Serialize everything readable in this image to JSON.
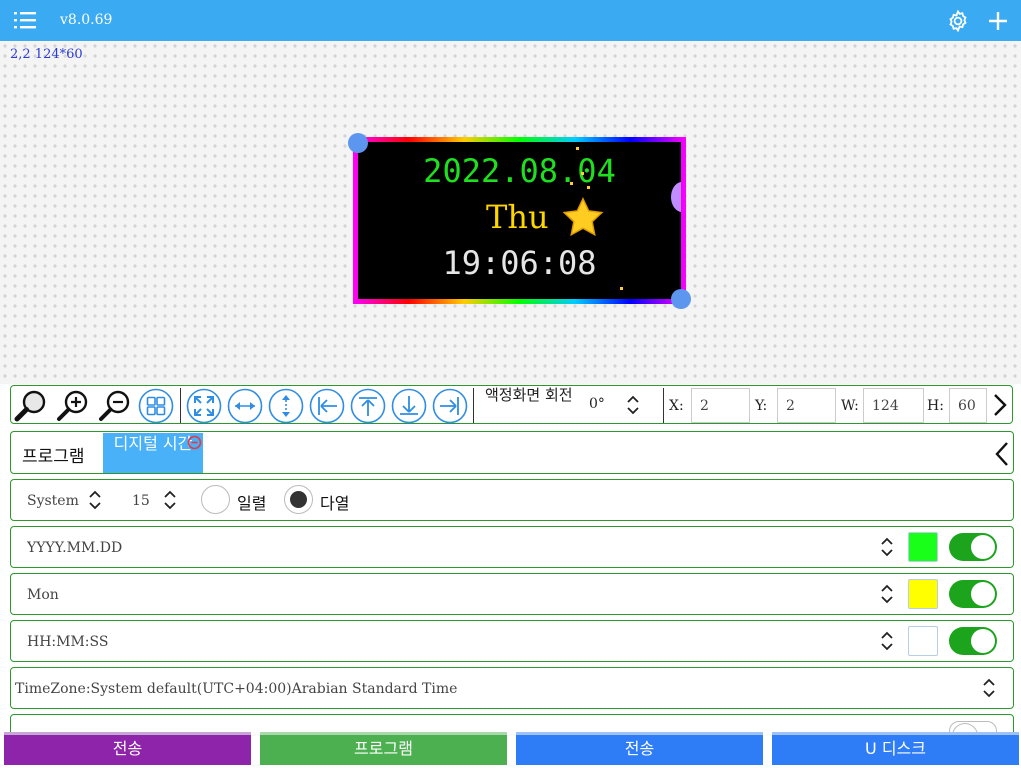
{
  "topbar": {
    "version": "v8.0.69",
    "menu_icon": "list-icon",
    "settings_icon": "gear-icon",
    "add_icon": "plus-icon",
    "background": "#3aaaf3"
  },
  "canvas": {
    "coordinate_readout": "2,2 124*60",
    "led": {
      "date": "2022.08.04",
      "day": "Thu",
      "time": "19:06:08",
      "date_color": "#1fe01f",
      "day_color": "#ffd500",
      "time_color": "#e6e6e6"
    }
  },
  "toolbar": {
    "icons": [
      "search-icon",
      "zoom-in-icon",
      "zoom-out-icon",
      "grid-icon",
      "expand-icon",
      "fit-width-icon",
      "fit-height-icon",
      "align-left-icon",
      "align-top-icon",
      "align-bottom-icon",
      "align-right-icon"
    ],
    "rotation_label": "액정화면 회전",
    "rotation_value": "0°",
    "x_label": "X:",
    "x_value": "2",
    "y_label": "Y:",
    "y_value": "2",
    "w_label": "W:",
    "w_value": "124",
    "h_label": "H:",
    "h_value": "60"
  },
  "program": {
    "title": "프로그램",
    "tab_label": "디지털 시간"
  },
  "options": {
    "font": "System",
    "size": "15",
    "radio_single": "일렬",
    "radio_multi": "다열",
    "selected": "multi"
  },
  "rows": [
    {
      "format": "YYYY.MM.DD",
      "color": "#19ff19",
      "enabled": true
    },
    {
      "format": "Mon",
      "color": "#ffff00",
      "enabled": true
    },
    {
      "format": "HH:MM:SS",
      "color": "#ffffff",
      "enabled": true
    }
  ],
  "timezone": "TimeZone:System default(UTC+04:00)Arabian Standard Time",
  "bottom_buttons": [
    {
      "label": "전송",
      "color": "#8e24aa"
    },
    {
      "label": "프로그램",
      "color": "#4caf50"
    },
    {
      "label": "전송",
      "color": "#2e7cf6"
    },
    {
      "label": "U 디스크",
      "color": "#2e7cf6"
    }
  ]
}
